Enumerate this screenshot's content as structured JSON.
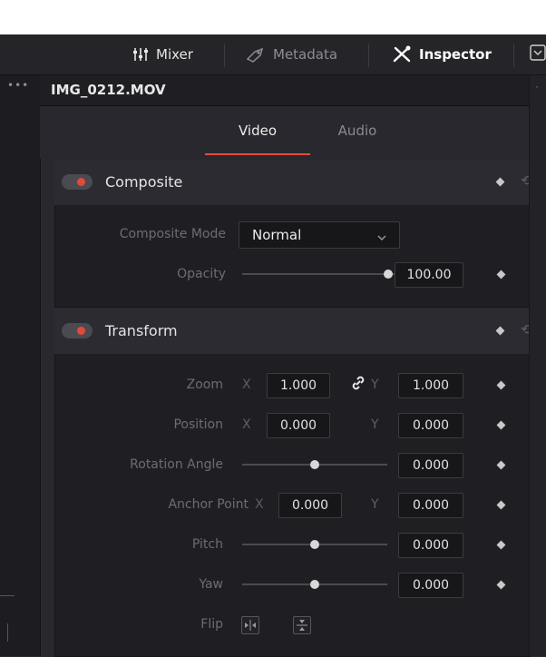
{
  "toolbar": {
    "mixer_label": "Mixer",
    "metadata_label": "Metadata",
    "inspector_label": "Inspector"
  },
  "header": {
    "clip_name": "IMG_0212.MOV"
  },
  "tabs": {
    "video": "Video",
    "audio": "Audio",
    "active": "Video"
  },
  "composite": {
    "title": "Composite",
    "enabled": true,
    "mode_label": "Composite Mode",
    "mode_value": "Normal",
    "opacity_label": "Opacity",
    "opacity_value": "100.00"
  },
  "transform": {
    "title": "Transform",
    "enabled": true,
    "zoom_label": "Zoom",
    "zoom_x": "1.000",
    "zoom_y": "1.000",
    "position_label": "Position",
    "position_x": "0.000",
    "position_y": "0.000",
    "rotation_label": "Rotation Angle",
    "rotation_value": "0.000",
    "anchor_label": "Anchor Point",
    "anchor_x": "0.000",
    "anchor_y": "0.000",
    "pitch_label": "Pitch",
    "pitch_value": "0.000",
    "yaw_label": "Yaw",
    "yaw_value": "0.000",
    "flip_label": "Flip",
    "axis_x": "X",
    "axis_y": "Y"
  },
  "colors": {
    "accent": "#e64b3c",
    "bg": "#28282e",
    "panel": "#1f1f23"
  }
}
